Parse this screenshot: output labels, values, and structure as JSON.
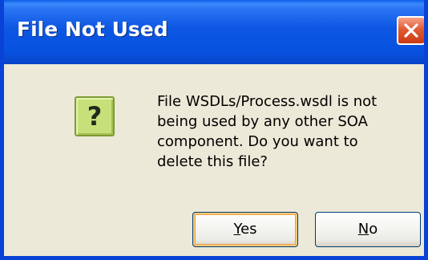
{
  "window": {
    "title": "File Not Used"
  },
  "icons": {
    "close": "close-icon",
    "question": "question-icon",
    "question_glyph": "?"
  },
  "message": {
    "text": "File WSDLs/Process.wsdl is not\nbeing used by any other SOA\ncomponent.  Do you want to\ndelete this file?"
  },
  "buttons": {
    "yes": {
      "accelerator": "Y",
      "rest": "es"
    },
    "no": {
      "accelerator": "N",
      "rest": "o"
    }
  },
  "colors": {
    "title_bar": "#0852e0",
    "dialog_background": "#ece9d8",
    "close_button": "#e15a33",
    "question_icon": "#c8e07a",
    "default_button_focus": "#f7c879"
  }
}
